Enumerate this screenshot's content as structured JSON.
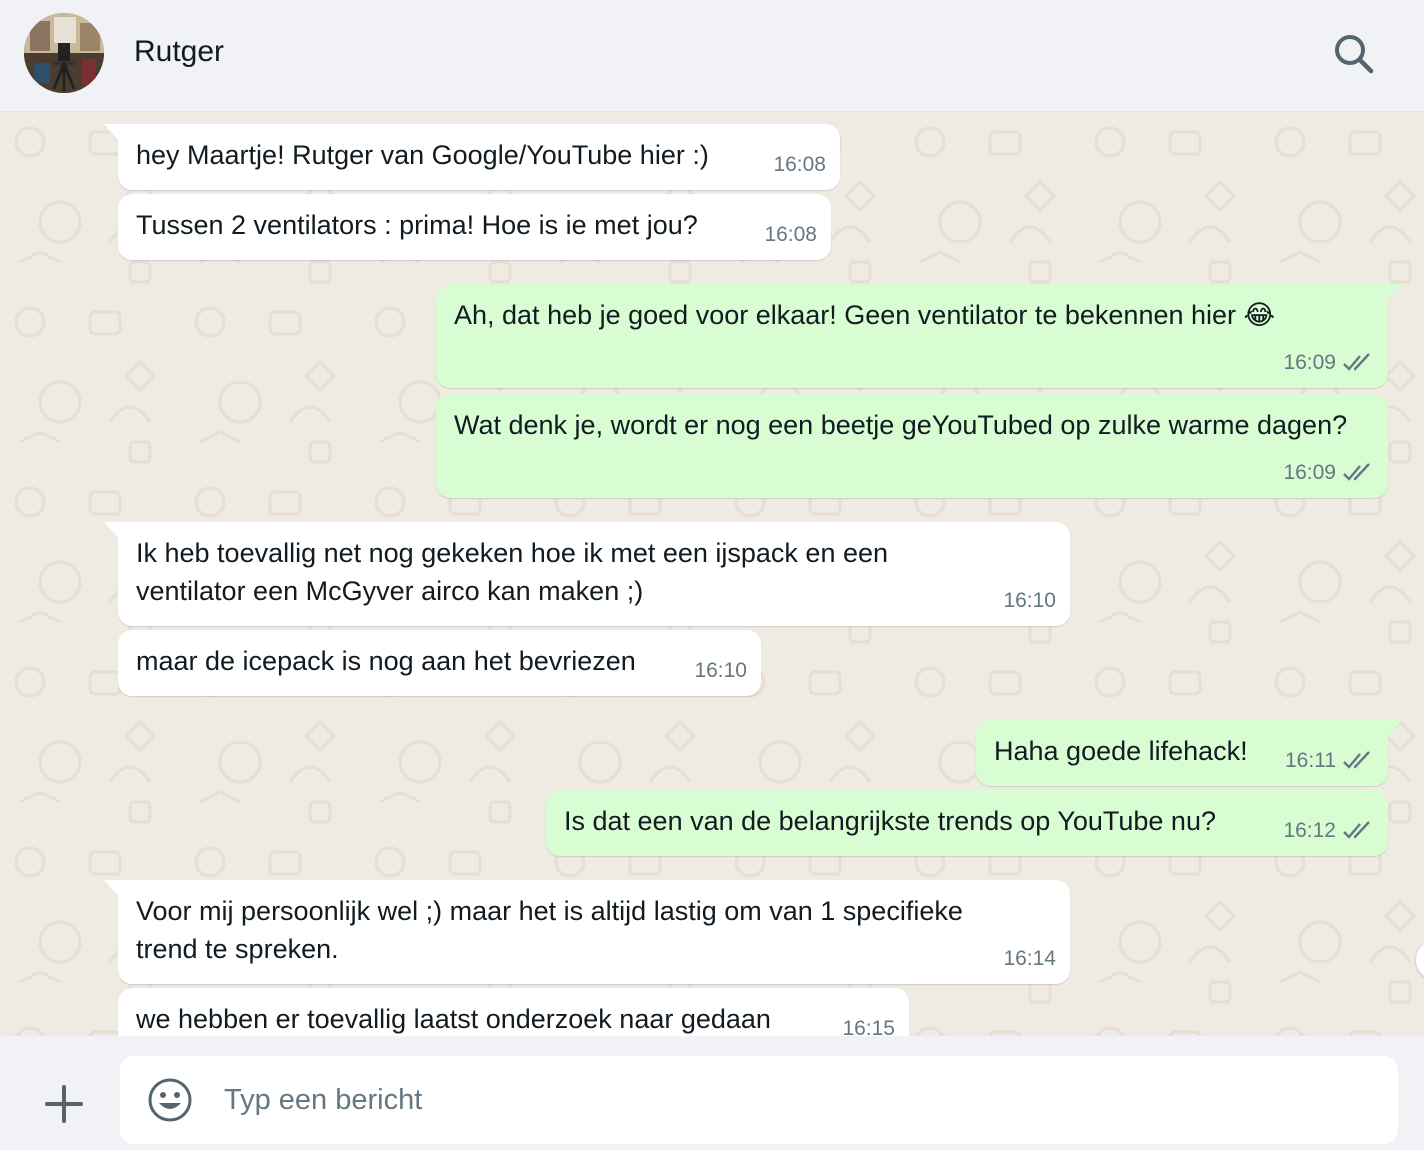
{
  "header": {
    "contact_name": "Rutger",
    "avatar_icon": "contact-photo",
    "search_icon": "search-icon"
  },
  "messages": [
    {
      "direction": "in",
      "text": "hey Maartje! Rutger van Google/YouTube hier :)",
      "time": "16:08"
    },
    {
      "direction": "in",
      "text": "Tussen 2 ventilators : prima! Hoe is ie met jou?",
      "time": "16:08"
    },
    {
      "direction": "out",
      "text": "Ah, dat heb je goed voor elkaar! Geen ventilator te bekennen hier 😂",
      "time": "16:09",
      "status": "read"
    },
    {
      "direction": "out",
      "text": "Wat denk je, wordt er nog een beetje geYouTubed op zulke warme dagen?",
      "time": "16:09",
      "status": "read"
    },
    {
      "direction": "in",
      "text": "Ik heb toevallig net nog gekeken hoe ik met een ijspack en een ventilator een McGyver airco kan maken ;)",
      "time": "16:10"
    },
    {
      "direction": "in",
      "text": "maar de icepack is nog aan het bevriezen",
      "time": "16:10"
    },
    {
      "direction": "out",
      "text": "Haha goede lifehack!",
      "time": "16:11",
      "status": "read"
    },
    {
      "direction": "out",
      "text": "Is dat een van de belangrijkste trends op YouTube nu?",
      "time": "16:12",
      "status": "read"
    },
    {
      "direction": "in",
      "text": "Voor mij persoonlijk wel ;) maar het is altijd lastig om van 1 specifieke trend te spreken.",
      "time": "16:14"
    },
    {
      "direction": "in",
      "text": "we hebben er toevallig laatst onderzoek naar gedaan",
      "time": "16:15"
    }
  ],
  "composer": {
    "placeholder": "Typ een bericht",
    "value": "",
    "plus_icon": "plus-icon",
    "emoji_icon": "emoji-icon"
  },
  "colors": {
    "incoming_bubble": "#ffffff",
    "outgoing_bubble": "#d9fdd3",
    "chat_background": "#efeae2",
    "header_background": "#f0f2f5",
    "read_ticks": "#667781"
  }
}
